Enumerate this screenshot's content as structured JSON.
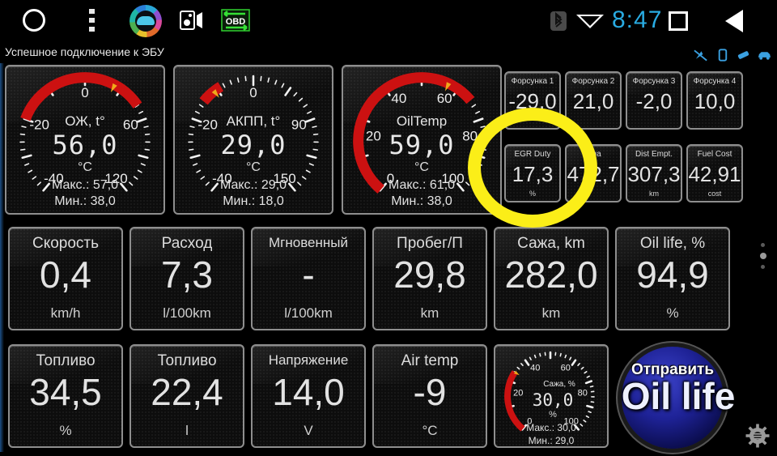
{
  "statusbar": {
    "time": "8:47",
    "icons": [
      "home-circle-icon",
      "overflow-menu-icon",
      "car-app-icon",
      "media-card-icon",
      "obd-icon",
      "bluetooth-icon",
      "wifi-icon",
      "recents-square-icon",
      "back-triangle-icon"
    ]
  },
  "connection": {
    "status_text": "Успешное подключение к ЭБУ"
  },
  "tray": {
    "icons": [
      "gps-off-icon",
      "phone-icon",
      "usb-icon",
      "car-icon"
    ]
  },
  "gauges": [
    {
      "label": "ОЖ, t°",
      "value": "56,0",
      "unit": "°C",
      "max_label": "Макс.: 57,0",
      "min_label": "Мин.: 38,0",
      "ticks": [
        "-40",
        "-20",
        "0",
        "60",
        "120"
      ],
      "scale_min": -40,
      "scale_max": 120,
      "arc_from": 0,
      "arc_to": 72,
      "needle": 56
    },
    {
      "label": "АКПП, t°",
      "value": "29,0",
      "unit": "°C",
      "max_label": "Макс.: 29,0",
      "min_label": "Мин.: 18,0",
      "ticks": [
        "-40",
        "-20",
        "0",
        "90",
        "150"
      ],
      "scale_min": -40,
      "scale_max": 150,
      "arc_from": 20,
      "arc_to": 34,
      "needle": 29
    },
    {
      "label": "OilTemp",
      "value": "59,0",
      "unit": "°C",
      "max_label": "Макс.: 61,0",
      "min_label": "Мин.: 38,0",
      "ticks": [
        "0",
        "20",
        "40",
        "60",
        "80",
        "100"
      ],
      "scale_min": 0,
      "scale_max": 100,
      "arc_from": 0,
      "arc_to": 68,
      "needle": 59
    }
  ],
  "small_tiles_row1": [
    {
      "label": "Форсунка 1",
      "value": "-29,0",
      "unit": ""
    },
    {
      "label": "Форсунка 2",
      "value": "21,0",
      "unit": ""
    },
    {
      "label": "Форсунка 3",
      "value": "-2,0",
      "unit": ""
    },
    {
      "label": "Форсунка 4",
      "value": "10,0",
      "unit": ""
    }
  ],
  "small_tiles_row2": [
    {
      "label": "EGR Duty",
      "value": "17,3",
      "unit": "%"
    },
    {
      "label": "...на",
      "value": "472,7",
      "unit": ""
    },
    {
      "label": "Dist Empt.",
      "value": "307,3",
      "unit": "km"
    },
    {
      "label": "Fuel Cost",
      "value": "42,91",
      "unit": "cost"
    }
  ],
  "tiles_row2": [
    {
      "label": "Скорость",
      "value": "0,4",
      "unit": "km/h"
    },
    {
      "label": "Расход",
      "value": "7,3",
      "unit": "l/100km"
    },
    {
      "label": "Мгновенный",
      "value": "-",
      "unit": "l/100km"
    },
    {
      "label": "Пробег/П",
      "value": "29,8",
      "unit": "km"
    },
    {
      "label": "Сажа, km",
      "value": "282,0",
      "unit": "km"
    },
    {
      "label": "Oil life, %",
      "value": "94,9",
      "unit": "%"
    }
  ],
  "tiles_row3": [
    {
      "label": "Топливо",
      "value": "34,5",
      "unit": "%"
    },
    {
      "label": "Топливо",
      "value": "22,4",
      "unit": "l"
    },
    {
      "label": "Напряжение",
      "value": "14,0",
      "unit": "V"
    },
    {
      "label": "Air temp",
      "value": "-9",
      "unit": "°C"
    }
  ],
  "mini_gauge": {
    "label": "Сажа, %",
    "value": "30,0",
    "unit": "%",
    "max_label": "Макс.: 30,0",
    "min_label": "Мин.: 29,0",
    "ticks": [
      "0",
      "20",
      "40",
      "60",
      "80",
      "100"
    ],
    "scale_min": 0,
    "scale_max": 100,
    "needle": 30
  },
  "oil_button": {
    "top_label": "Отправить",
    "main_label": "Oil life"
  },
  "settings": {
    "icon": "gear-icon"
  },
  "colors": {
    "accent_blue": "#29abe2",
    "annotation_yellow": "#fbee18",
    "gauge_arc_red": "#cc1111",
    "tile_border": "#8e8e8e",
    "background": "#000000"
  }
}
